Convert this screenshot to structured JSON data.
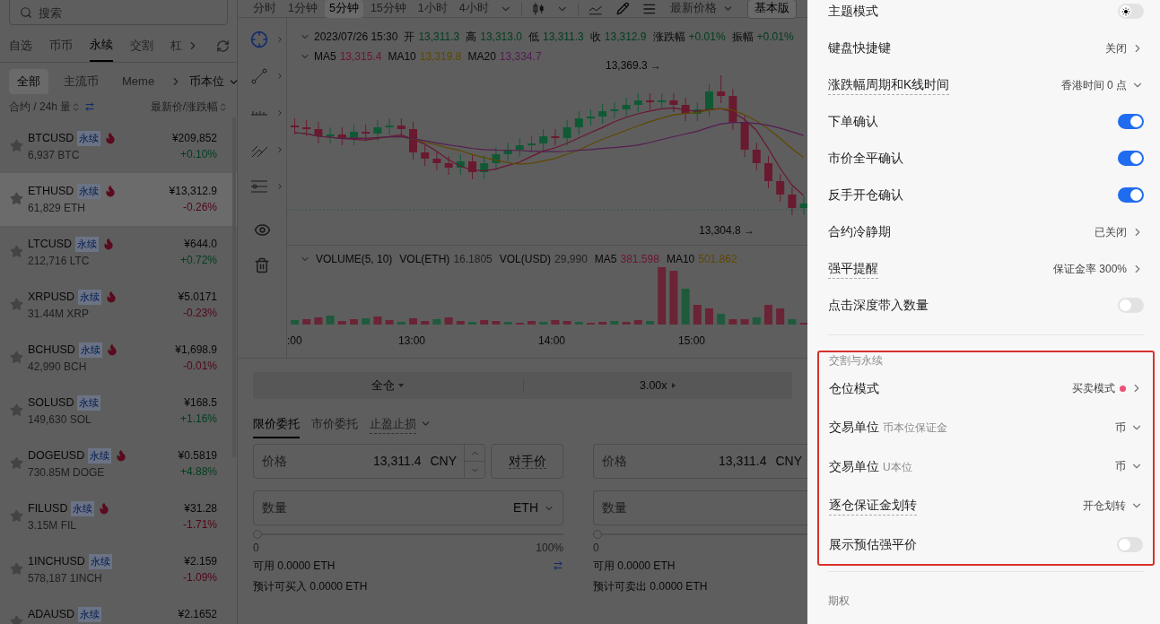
{
  "sidebar": {
    "search": {
      "placeholder": "搜索"
    },
    "tabs": [
      {
        "label": "自选",
        "selected": false
      },
      {
        "label": "币币",
        "selected": false
      },
      {
        "label": "永续",
        "selected": true
      },
      {
        "label": "交割",
        "selected": false
      },
      {
        "label": "杠",
        "selected": false
      }
    ],
    "filters": [
      {
        "label": "全部",
        "selected": true
      },
      {
        "label": "主流币",
        "selected": false
      },
      {
        "label": "Meme",
        "selected": false
      }
    ],
    "unit": "币本位",
    "sort_left": "合约 / 24h 量",
    "sort_right": "最新价/涨跌幅",
    "markets": [
      {
        "symbol": "BTCUSD",
        "tag": "永续",
        "hot": true,
        "volume": "6,937 BTC",
        "price": "¥209,852",
        "change": "+0.10%",
        "rising": true,
        "selected": false
      },
      {
        "symbol": "ETHUSD",
        "tag": "永续",
        "hot": true,
        "volume": "61,829 ETH",
        "price": "¥13,312.9",
        "change": "-0.26%",
        "rising": false,
        "selected": true
      },
      {
        "symbol": "LTCUSD",
        "tag": "永续",
        "hot": true,
        "volume": "212,716 LTC",
        "price": "¥644.0",
        "change": "+0.72%",
        "rising": true,
        "selected": false
      },
      {
        "symbol": "XRPUSD",
        "tag": "永续",
        "hot": true,
        "volume": "31.44M XRP",
        "price": "¥5.0171",
        "change": "-0.23%",
        "rising": false,
        "selected": false
      },
      {
        "symbol": "BCHUSD",
        "tag": "永续",
        "hot": true,
        "volume": "42,990 BCH",
        "price": "¥1,698.9",
        "change": "-0.01%",
        "rising": false,
        "selected": false
      },
      {
        "symbol": "SOLUSD",
        "tag": "永续",
        "hot": false,
        "volume": "149,630 SOL",
        "price": "¥168.5",
        "change": "+1.16%",
        "rising": true,
        "selected": false
      },
      {
        "symbol": "DOGEUSD",
        "tag": "永续",
        "hot": true,
        "volume": "730.85M DOGE",
        "price": "¥0.5819",
        "change": "+4.88%",
        "rising": true,
        "selected": false
      },
      {
        "symbol": "FILUSD",
        "tag": "永续",
        "hot": true,
        "volume": "3.15M FIL",
        "price": "¥31.28",
        "change": "-1.71%",
        "rising": false,
        "selected": false
      },
      {
        "symbol": "1INCHUSD",
        "tag": "永续",
        "hot": false,
        "volume": "578,187 1INCH",
        "price": "¥2.159",
        "change": "-1.09%",
        "rising": false,
        "selected": false
      },
      {
        "symbol": "ADAUSD",
        "tag": "永续",
        "hot": false,
        "price": "¥2.1652",
        "selected": false
      }
    ]
  },
  "chart": {
    "intervals": [
      {
        "label": "分时",
        "selected": false
      },
      {
        "label": "1分钟",
        "selected": false
      },
      {
        "label": "5分钟",
        "selected": true
      },
      {
        "label": "15分钟",
        "selected": false
      },
      {
        "label": "1小时",
        "selected": false
      },
      {
        "label": "4小时",
        "selected": false
      }
    ],
    "price_type": "最新价格",
    "version": "基本版",
    "date": "2023/07/26 15:30",
    "ohlc": [
      {
        "label": "开",
        "value": "13,311.3"
      },
      {
        "label": "高",
        "value": "13,313.0"
      },
      {
        "label": "低",
        "value": "13,311.3"
      },
      {
        "label": "收",
        "value": "13,312.9"
      },
      {
        "label": "涨跌幅",
        "value": "+0.01%"
      },
      {
        "label": "振幅",
        "value": "+0.01%"
      }
    ],
    "ma": [
      {
        "label": "MA5",
        "value": "13,315.4",
        "color": "#6a1633"
      },
      {
        "label": "MA10",
        "value": "13,319.8",
        "color": "#5e4800"
      },
      {
        "label": "MA20",
        "value": "13,334.7",
        "color": "#551d52"
      }
    ],
    "high_label": "13,369.3 →",
    "low_label": "13,304.8 →",
    "volume": {
      "title": "VOLUME(5, 10)",
      "items": [
        {
          "label": "VOL(ETH)",
          "value": "16.1805",
          "color": "#222222"
        },
        {
          "label": "VOL(USD)",
          "value": "29,990",
          "color": "#222222"
        },
        {
          "label": "MA5",
          "value": "381.598",
          "color": "#6a1633"
        },
        {
          "label": "MA10",
          "value": "501.862",
          "color": "#5e4800"
        }
      ]
    },
    "time_labels": [
      ":00",
      "13:00",
      "14:00",
      "15:00"
    ]
  },
  "order": {
    "margin_mode": "全仓",
    "leverage": "3.00x",
    "tabs": [
      {
        "label": "限价委托",
        "selected": true,
        "menu": false
      },
      {
        "label": "市价委托",
        "selected": false,
        "menu": false
      },
      {
        "label": "止盈止损",
        "selected": false,
        "menu": true
      }
    ],
    "buy": {
      "price_label": "价格",
      "price": "13,311.4",
      "currency": "CNY",
      "counter_price": "对手价",
      "qty_label": "数量",
      "qty_unit": "ETH",
      "level": 0,
      "min": "0",
      "max": "100%",
      "available": "可用 0.0000 ETH",
      "estimate": "预计可买入 0.0000 ETH"
    },
    "sell": {
      "price_label": "价格",
      "price": "13,311.4",
      "currency": "CNY",
      "qty_label": "数量",
      "level": 0,
      "min": "0",
      "available": "可用 0.0000 ETH",
      "estimate": "预计可卖出 0.0000 ETH"
    }
  },
  "settings": {
    "items": [
      {
        "kind": "theme",
        "label": "主题模式",
        "on": false,
        "hint": false
      },
      {
        "kind": "link",
        "label": "键盘快捷键",
        "value": "关闭",
        "hint": false
      },
      {
        "kind": "select",
        "label": "涨跌幅周期和K线时间",
        "value": "香港时间 0 点",
        "hint": true
      },
      {
        "kind": "toggle",
        "label": "下单确认",
        "on": true,
        "hint": false
      },
      {
        "kind": "toggle",
        "label": "市价全平确认",
        "on": true,
        "hint": false
      },
      {
        "kind": "toggle",
        "label": "反手开仓确认",
        "on": true,
        "hint": false
      },
      {
        "kind": "link",
        "label": "合约冷静期",
        "value": "已关闭",
        "hint": false
      },
      {
        "kind": "link",
        "label": "强平提醒",
        "value": "保证金率 300%",
        "hint": true
      },
      {
        "kind": "toggle",
        "label": "点击深度带入数量",
        "on": false,
        "hint": false
      }
    ],
    "section": {
      "title": "交割与永续",
      "highlighted": true,
      "items": [
        {
          "kind": "link",
          "label": "仓位模式",
          "value": "买卖模式",
          "badge": true,
          "hint": false
        },
        {
          "kind": "select",
          "label": "交易单位",
          "sublabel": "币本位保证金",
          "value": "币",
          "hint": false
        },
        {
          "kind": "select",
          "label": "交易单位",
          "sublabel": "U本位",
          "value": "币",
          "hint": false
        },
        {
          "kind": "select",
          "label": "逐仓保证金划转",
          "value": "开仓划转",
          "hint": true
        },
        {
          "kind": "toggle",
          "label": "展示预估强平价",
          "on": false,
          "hint": false
        }
      ]
    },
    "next_section": "期权"
  }
}
